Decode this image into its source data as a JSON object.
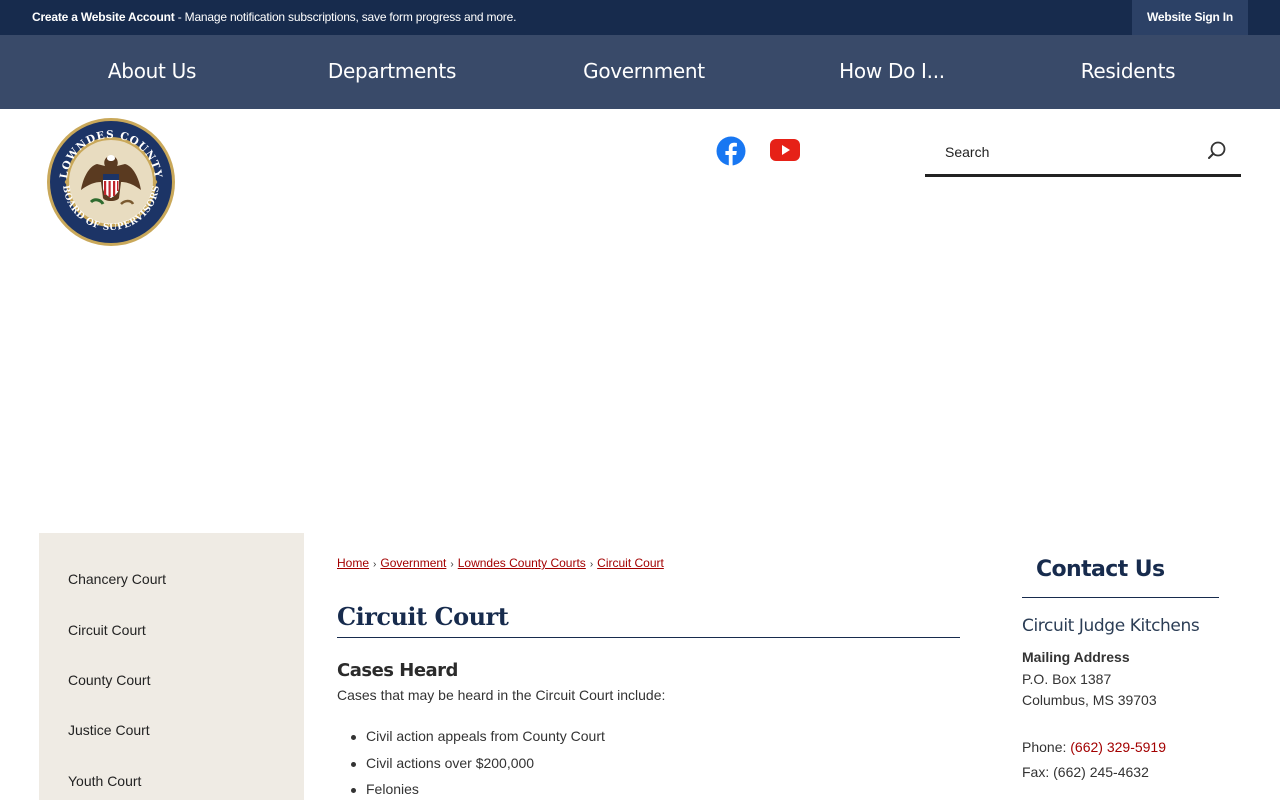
{
  "topbar": {
    "create_label": "Create a Website Account",
    "create_desc": " - Manage notification subscriptions, save form progress and more.",
    "signin_label": "Website Sign In"
  },
  "nav": {
    "items": [
      {
        "label": "About Us"
      },
      {
        "label": "Departments"
      },
      {
        "label": "Government"
      },
      {
        "label": "How Do I..."
      },
      {
        "label": "Residents"
      }
    ]
  },
  "logo": {
    "seal_text_top": "LOWNDES COUNTY",
    "seal_text_bottom": "BOARD OF SUPERVISORS"
  },
  "social": {
    "facebook_icon": "facebook-icon",
    "youtube_icon": "youtube-icon",
    "facebook_color": "#1877f2",
    "youtube_color": "#e62117"
  },
  "search": {
    "placeholder": "Search"
  },
  "sidebar": {
    "items": [
      {
        "label": "Chancery Court"
      },
      {
        "label": "Circuit Court"
      },
      {
        "label": "County Court"
      },
      {
        "label": "Justice Court"
      },
      {
        "label": "Youth Court"
      }
    ]
  },
  "breadcrumb": {
    "items": [
      {
        "label": "Home"
      },
      {
        "label": "Government"
      },
      {
        "label": "Lowndes County Courts"
      },
      {
        "label": "Circuit Court"
      }
    ],
    "separator": "›"
  },
  "main": {
    "title": "Circuit Court",
    "cases_heading": "Cases Heard",
    "cases_intro": "Cases that may be heard in the Circuit Court include:",
    "cases": [
      "Civil action appeals from County Court",
      "Civil actions over $200,000",
      "Felonies"
    ]
  },
  "contact": {
    "heading": "Contact Us",
    "name": "Circuit Judge Kitchens",
    "mailing_heading": "Mailing Address",
    "address_line1": "P.O. Box 1387",
    "address_line2": "Columbus, MS 39703",
    "phone_label": "Phone: ",
    "phone_value": "(662) 329-5919",
    "fax": "Fax: (662) 245-4632"
  },
  "colors": {
    "topbar_bg": "#172b4d",
    "nav_bg": "#394a69",
    "sidebar_bg": "#efebe4",
    "link_red": "#a30000"
  }
}
